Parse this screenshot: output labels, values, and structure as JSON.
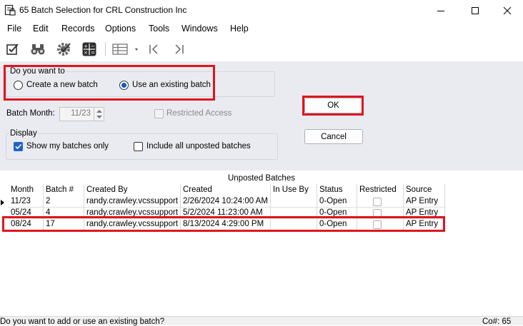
{
  "window": {
    "title": "65 Batch Selection for CRL Construction Inc",
    "app_icon": "document-lock-icon"
  },
  "menu": [
    "File",
    "Edit",
    "Records",
    "Options",
    "Tools",
    "Windows",
    "Help"
  ],
  "toolbar": {
    "icons": [
      "edit-check-icon",
      "binoculars-icon",
      "gear-check-icon",
      "calculator-icon",
      "table-options-icon",
      "first-record-icon",
      "last-record-icon"
    ]
  },
  "choice": {
    "group_label": "Do you want to",
    "create_label": "Create a new batch",
    "existing_label": "Use an existing batch",
    "selected": "existing"
  },
  "batch_month": {
    "label": "Batch Month:",
    "value": "11/23"
  },
  "restricted": {
    "label": "Restricted Access",
    "checked": false
  },
  "display": {
    "group_label": "Display",
    "show_mine_label": "Show my batches only",
    "show_mine_checked": true,
    "include_all_label": "Include all unposted batches",
    "include_all_checked": false
  },
  "buttons": {
    "ok": "OK",
    "cancel": "Cancel"
  },
  "grid": {
    "title": "Unposted Batches",
    "columns": [
      "Month",
      "Batch #",
      "Created By",
      "Created",
      "In Use By",
      "Status",
      "Restricted",
      "Source"
    ],
    "rows": [
      {
        "month": "11/23",
        "batch": "2",
        "created_by": "randy.crawley.vcssupport",
        "created": "2/26/2024 10:24:00 AM",
        "in_use_by": "",
        "status": "0-Open",
        "restricted": false,
        "source": "AP Entry"
      },
      {
        "month": "05/24",
        "batch": "4",
        "created_by": "randy.crawley.vcssupport",
        "created": "5/2/2024 11:23:00 AM",
        "in_use_by": "",
        "status": "0-Open",
        "restricted": false,
        "source": "AP Entry"
      },
      {
        "month": "08/24",
        "batch": "17",
        "created_by": "randy.crawley.vcssupport",
        "created": "8/13/2024 4:29:00 PM",
        "in_use_by": "",
        "status": "0-Open",
        "restricted": false,
        "source": "AP Entry"
      }
    ]
  },
  "status_bar": {
    "message": "Do you want to add or use an existing batch?",
    "company": "Co#: 65"
  },
  "colors": {
    "highlight_border": "#e0141e",
    "form_background": "#e9ebf0",
    "accent": "#1f63c8"
  }
}
